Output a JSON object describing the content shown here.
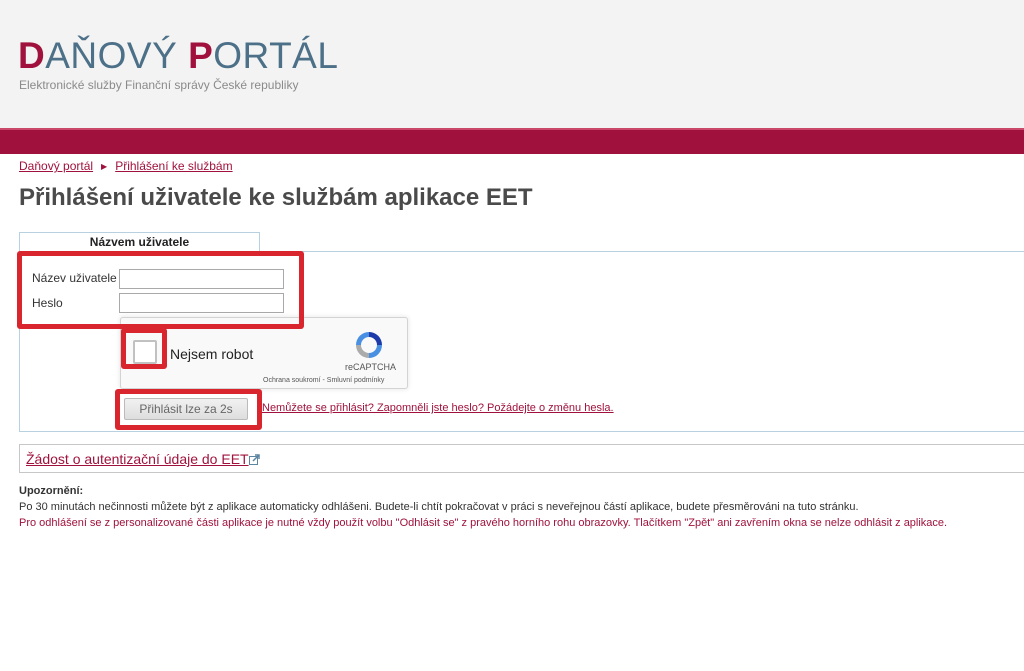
{
  "header": {
    "logo_first_letter_1": "D",
    "logo_rest_1": "AŇOVÝ ",
    "logo_first_letter_2": "P",
    "logo_rest_2": "ORTÁL",
    "subtitle": "Elektronické služby Finanční správy České republiky"
  },
  "breadcrumb": {
    "items": [
      "Daňový portál",
      "Přihlášení ke službám"
    ],
    "separator_icon": "triangle-right-icon"
  },
  "page_title": "Přihlášení uživatele ke službám aplikace EET",
  "login": {
    "tab_label": "Názvem uživatele",
    "username_label": "Název uživatele",
    "username_value": "",
    "password_label": "Heslo",
    "password_value": "",
    "recaptcha": {
      "checkbox_label": "Nejsem robot",
      "brand": "reCAPTCHA",
      "links": "Ochrana soukromí - Smluvní podmínky",
      "icon": "recaptcha-logo-icon"
    },
    "submit_label": "Přihlásit lze za 2s",
    "forgot_text": "Nemůžete se přihlásit? Zapomněli jste heslo? Požádejte o změnu hesla."
  },
  "eet_request": {
    "link_text": "Žádost o autentizační údaje do EET",
    "icon": "external-link-icon"
  },
  "warning": {
    "title": "Upozornění:",
    "line1": "Po 30 minutách nečinnosti můžete být z aplikace automaticky odhlášeni. Budete-li chtít pokračovat v práci s neveřejnou částí aplikace, budete přesměrováni na tuto stránku.",
    "line2": "Pro odhlášení se z personalizované části aplikace je nutné vždy použít volbu \"Odhlásit se\" z pravého horního rohu obrazovky. Tlačítkem \"Zpět\" ani zavřením okna se nelze odhlásit z aplikace."
  },
  "colors": {
    "brand_red": "#a0123d",
    "brand_blue": "#4d7089",
    "highlight": "#d9262e"
  }
}
